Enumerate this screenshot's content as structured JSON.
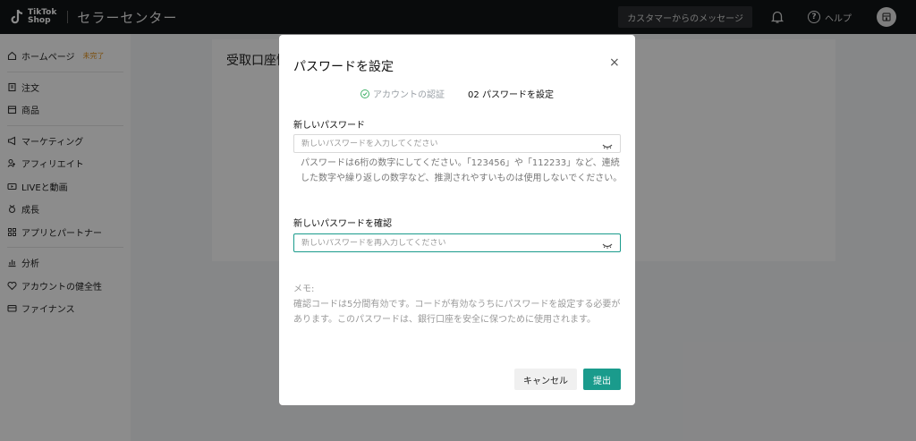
{
  "header": {
    "logo_line1": "TikTok",
    "logo_line2": "Shop",
    "app_title": "セラーセンター",
    "messages_label": "カスタマーからのメッセージ",
    "help_label": "ヘルプ"
  },
  "sidebar": {
    "items": [
      {
        "label": "ホームページ",
        "badge": "未完了",
        "icon": "home-icon"
      },
      {
        "label": "注文",
        "icon": "order-icon"
      },
      {
        "label": "商品",
        "icon": "product-icon"
      },
      {
        "label": "マーケティング",
        "icon": "megaphone-icon"
      },
      {
        "label": "アフィリエイト",
        "icon": "affiliate-icon"
      },
      {
        "label": "LIVEと動画",
        "icon": "video-icon"
      },
      {
        "label": "成長",
        "icon": "growth-icon"
      },
      {
        "label": "アプリとパートナー",
        "icon": "apps-icon"
      },
      {
        "label": "分析",
        "icon": "chart-icon"
      },
      {
        "label": "アカウントの健全性",
        "icon": "health-icon"
      },
      {
        "label": "ファイナンス",
        "icon": "finance-icon"
      }
    ]
  },
  "main": {
    "title": "受取口座情"
  },
  "modal": {
    "title": "パスワードを設定",
    "close": "×",
    "step1": "アカウントの認証",
    "step2": "02 パスワードを設定",
    "new_password_label": "新しいパスワード",
    "new_password_placeholder": "新しいパスワードを入力してください",
    "new_password_value": "",
    "hint": "パスワードは6桁の数字にしてください。「123456」や「112233」など、連続した数字や繰り返しの数字など、推測されやすいものは使用しないでください。",
    "confirm_label": "新しいパスワードを確認",
    "confirm_placeholder": "新しいパスワードを再入力してください",
    "confirm_value": "",
    "memo_title": "メモ:",
    "memo_text": "確認コードは5分間有効です。コードが有効なうちにパスワードを設定する必要があります。このパスワードは、銀行口座を安全に保つために使用されます。",
    "cancel_label": "キャンセル",
    "submit_label": "提出"
  },
  "colors": {
    "accent": "#1a9b8c",
    "badge": "#e0901a",
    "topbar": "#111416"
  }
}
